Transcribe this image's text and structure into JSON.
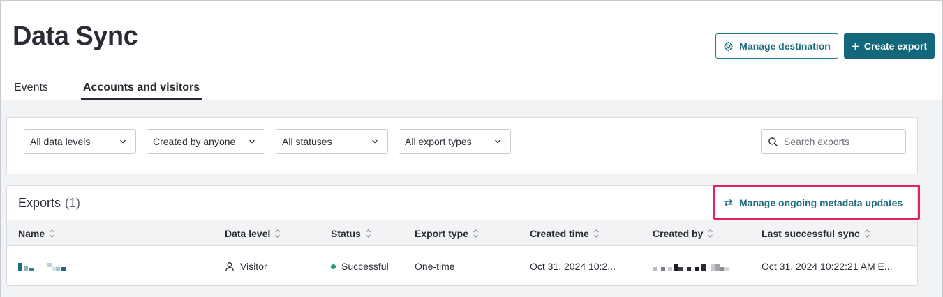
{
  "header": {
    "title": "Data Sync",
    "manage_destination_label": "Manage destination",
    "create_export_label": "Create export"
  },
  "tabs": [
    {
      "label": "Events",
      "active": false
    },
    {
      "label": "Accounts and visitors",
      "active": true
    }
  ],
  "filters": {
    "data_levels": "All data levels",
    "created_by": "Created by anyone",
    "statuses": "All statuses",
    "export_types": "All export types",
    "search_placeholder": "Search exports"
  },
  "exports": {
    "title": "Exports",
    "count": "(1)",
    "manage_link": "Manage ongoing metadata updates",
    "columns": [
      "Name",
      "Data level",
      "Status",
      "Export type",
      "Created time",
      "Created by",
      "Last successful sync"
    ],
    "rows": [
      {
        "name": "",
        "data_level": "Visitor",
        "status": "Successful",
        "export_type": "One-time",
        "created_time": "Oct 31, 2024 10:2...",
        "created_by": "",
        "last_sync": "Oct 31, 2024 10:22:21 AM E..."
      }
    ]
  },
  "colors": {
    "accent": "#12677a",
    "link": "#1f6f7f",
    "highlight": "#e0245e",
    "success": "#1aa36f"
  },
  "icons": [
    "gear-icon",
    "plus-icon",
    "chevron-down-icon",
    "search-icon",
    "sync-arrows-icon",
    "sort-icon",
    "person-icon"
  ]
}
